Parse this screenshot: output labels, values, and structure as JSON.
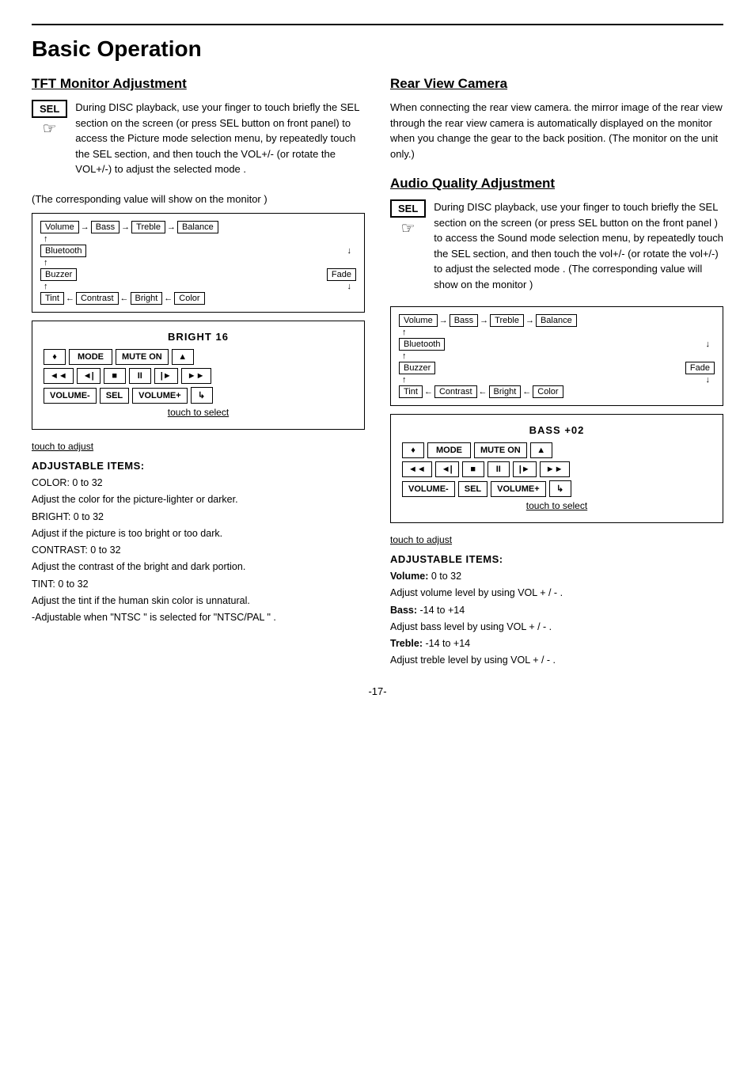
{
  "page": {
    "title": "Basic Operation",
    "page_number": "-17-"
  },
  "tft_section": {
    "heading": "TFT Monitor Adjustment",
    "sel_label": "SEL",
    "description1": "During DISC playback, use your finger to touch briefly the SEL section on the screen (or press SEL button on front panel) to access the Picture mode selection menu, by repeatedly touch the SEL section, and then touch the VOL+/- (or rotate the VOL+/-) to adjust the selected mode .",
    "description2": "(The corresponding value will show on the monitor )",
    "flow": {
      "top": [
        "Volume",
        "Bass",
        "Treble",
        "Balance"
      ],
      "left_col": [
        "Bluetooth",
        "Buzzer"
      ],
      "right_col": [
        "Fade"
      ],
      "bottom": [
        "Tint",
        "Contrast",
        "Bright",
        "Color"
      ]
    },
    "panel": {
      "title": "BRIGHT  16",
      "row1": [
        "♦",
        "MODE",
        "MUTE ON",
        "▲"
      ],
      "row2": [
        "◄◄",
        "◄|",
        "■",
        "II",
        "►|",
        "►►"
      ],
      "row3": [
        "VOLUME-",
        "SEL",
        "VOLUME+",
        "↳"
      ]
    },
    "touch_select": "touch to select",
    "touch_adjust": "touch to adjust",
    "adj_heading": "ADJUSTABLE  ITEMS:",
    "adj_items": [
      "COLOR: 0 to 32",
      "Adjust the color for the picture-lighter or darker.",
      "BRIGHT: 0 to 32",
      "Adjust if the picture is too bright or too dark.",
      "CONTRAST: 0 to 32",
      "Adjust the contrast of the bright and dark portion.",
      "TINT: 0 to 32",
      "Adjust the tint if the human skin color is unnatural.",
      "-Adjustable when \"NTSC \" is selected for \"NTSC/PAL \" ."
    ]
  },
  "rear_section": {
    "heading": "Rear View Camera",
    "text": "When connecting the rear view camera. the mirror image of the rear view through the rear view camera is automatically displayed on the monitor when you change  the gear to the back position. (The monitor on the unit only.)"
  },
  "audio_section": {
    "heading": "Audio Quality Adjustment",
    "sel_label": "SEL",
    "description1": "During DISC playback, use your finger to touch briefly the SEL section on the screen (or press SEL button on the front panel ) to access the Sound mode selection menu, by repeatedly touch the SEL section, and then touch the vol+/- (or rotate the vol+/-) to adjust the selected mode . (The corresponding value will show on the monitor )",
    "flow": {
      "top": [
        "Volume",
        "Bass",
        "Treble",
        "Balance"
      ],
      "left_col": [
        "Bluetooth",
        "Buzzer"
      ],
      "right_col": [
        "Fade"
      ],
      "bottom": [
        "Tint",
        "Contrast",
        "Bright",
        "Color"
      ]
    },
    "panel": {
      "title": "BASS +02",
      "row1": [
        "♦",
        "MODE",
        "MUTE ON",
        "▲"
      ],
      "row2": [
        "◄◄",
        "◄|",
        "■",
        "II",
        "►|",
        "►►"
      ],
      "row3": [
        "VOLUME-",
        "SEL",
        "VOLUME+",
        "↳"
      ]
    },
    "touch_select": "touch to select",
    "touch_adjust": "touch to adjust",
    "adj_heading": "ADJUSTABLE  ITEMS:",
    "adj_items": [
      {
        "label": "Volume:",
        "text": " 0 to 32"
      },
      {
        "label": "",
        "text": " Adjust volume level by using VOL + / - ."
      },
      {
        "label": "Bass:",
        "text": " -14 to +14"
      },
      {
        "label": "",
        "text": " Adjust bass level by using VOL + / - ."
      },
      {
        "label": "Treble:",
        "text": " -14 to +14"
      },
      {
        "label": "",
        "text": " Adjust treble level by using VOL + / - ."
      }
    ]
  }
}
